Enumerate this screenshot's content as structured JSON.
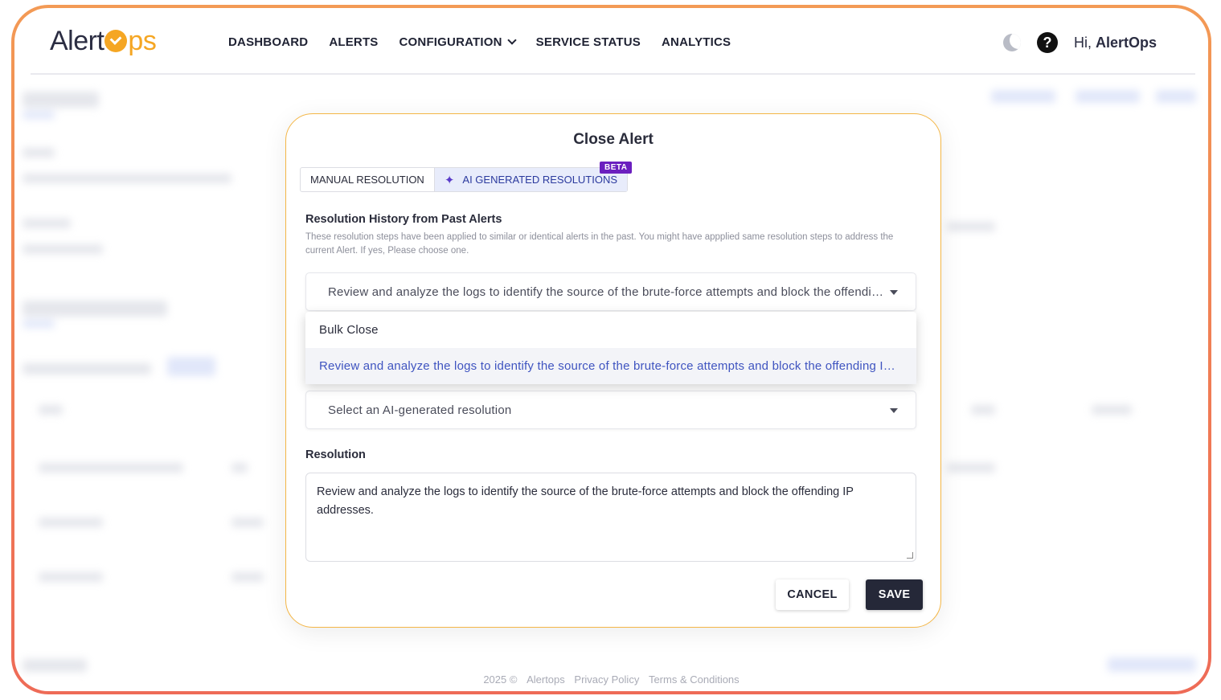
{
  "brand": {
    "logo_left": "Alert",
    "logo_right": "ps"
  },
  "nav": [
    {
      "label": "DASHBOARD"
    },
    {
      "label": "ALERTS"
    },
    {
      "label": "CONFIGURATION"
    },
    {
      "label": "SERVICE STATUS"
    },
    {
      "label": "ANALYTICS"
    }
  ],
  "user": {
    "greeting": "Hi,",
    "name": "AlertOps"
  },
  "icons": {
    "theme": "moon-icon",
    "help": "help-icon",
    "help_glyph": "?"
  },
  "modal": {
    "title": "Close Alert",
    "tabs": [
      {
        "label": "MANUAL RESOLUTION"
      },
      {
        "label": "AI GENERATED RESOLUTIONS",
        "badge": "BETA"
      }
    ],
    "history": {
      "title": "Resolution History from Past Alerts",
      "description": "These resolution steps have been applied to similar or identical alerts in the past. You might have appplied same resolution steps to address the current Alert. If yes, Please choose one.",
      "selected": "Review and analyze the logs to identify the source of the brute-force attempts and block the offending IP addresses.",
      "options": [
        "Bulk Close",
        "Review and analyze the logs to identify the source of the brute-force attempts and block the offending IP addresses."
      ]
    },
    "ai_select": {
      "placeholder": "Select an AI-generated resolution"
    },
    "resolution": {
      "label": "Resolution",
      "value": "Review and analyze the logs to identify the source of the brute-force attempts and block the offending IP addresses."
    },
    "buttons": {
      "cancel": "CANCEL",
      "save": "SAVE"
    }
  },
  "footer": {
    "year": "2025 ©",
    "company": "Alertops",
    "privacy": "Privacy Policy",
    "terms": "Terms & Conditions"
  },
  "colors": {
    "frame_gradient_start": "#f39a55",
    "frame_gradient_end": "#ee6b57",
    "modal_border": "#f4b646",
    "logo_accent": "#f5a623",
    "beta_badge": "#6b1fbf",
    "save_button": "#252838"
  }
}
